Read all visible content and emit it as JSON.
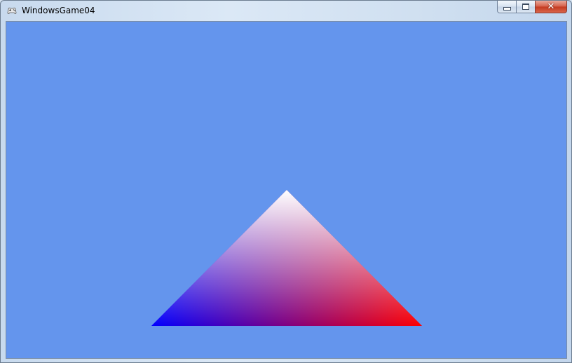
{
  "window": {
    "title": "WindowsGame04",
    "icon": "gamepad-icon",
    "controls": {
      "minimize_icon": "minimize-icon",
      "maximize_icon": "maximize-icon",
      "close_icon": "close-icon",
      "close_glyph": "✕"
    }
  },
  "scene": {
    "background_color": "#6495ED",
    "triangle": {
      "vertex_colors": {
        "top": "#FFFFFF",
        "bottom_left": "#0000FF",
        "bottom_right": "#FF0000"
      }
    }
  }
}
